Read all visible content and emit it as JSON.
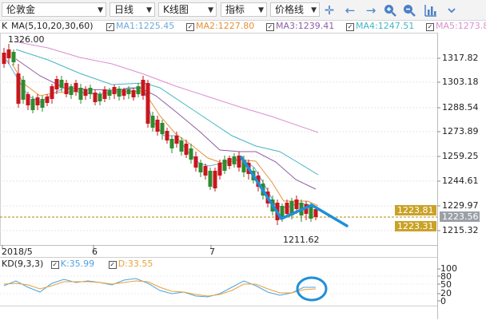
{
  "toolbar": {
    "symbol_select": "伦敦金",
    "period_select": "日线",
    "chart_type_select": "K线图",
    "indicator_select": "指标",
    "line_type_select": "价格线",
    "icons": [
      "crosshair-icon",
      "arrow-left-icon",
      "arrow-right-icon",
      "zoom-in-icon",
      "zoom-out-icon",
      "bar-chart-icon"
    ]
  },
  "legend": {
    "k_label": "K",
    "ma_params": "MA(5,10,20,30,60)",
    "ma1": "MA1:1225.45",
    "ma2": "MA2:1227.80",
    "ma3": "MA3:1239.41",
    "ma4": "MA4:1247.51",
    "ma5": "MA5:1273.8",
    "colors": {
      "ma1": "#6fa8dc",
      "ma2": "#e69138",
      "ma3": "#8e5ea2",
      "ma4": "#45b5c4",
      "ma5": "#d98fcf"
    }
  },
  "price_axis": {
    "labels": [
      "1317.82",
      "1303.18",
      "1288.54",
      "1273.89",
      "1259.25",
      "1244.61",
      "1229.97",
      "1215.32"
    ],
    "tags": [
      {
        "text": "1223.81",
        "color": "#c9a227"
      },
      {
        "text": "1223.56",
        "color": "#9aa0a6"
      },
      {
        "text": "1223.31",
        "color": "#c9a227"
      }
    ]
  },
  "annotations": {
    "high_label": "1326.00",
    "low_label": "1211.62"
  },
  "time_axis": {
    "labels": [
      "2018/5",
      "6",
      "7"
    ]
  },
  "kd": {
    "params": "KD(9,3,3)",
    "k_value": "K:35.99",
    "d_value": "D:33.55",
    "levels": [
      "100",
      "80",
      "50",
      "20",
      "0"
    ]
  },
  "colors": {
    "up": "#c8161d",
    "down": "#2e8b2e",
    "kline": "#4fa3e0",
    "dline": "#e6a23c",
    "drawn": "#1e90d8"
  }
}
